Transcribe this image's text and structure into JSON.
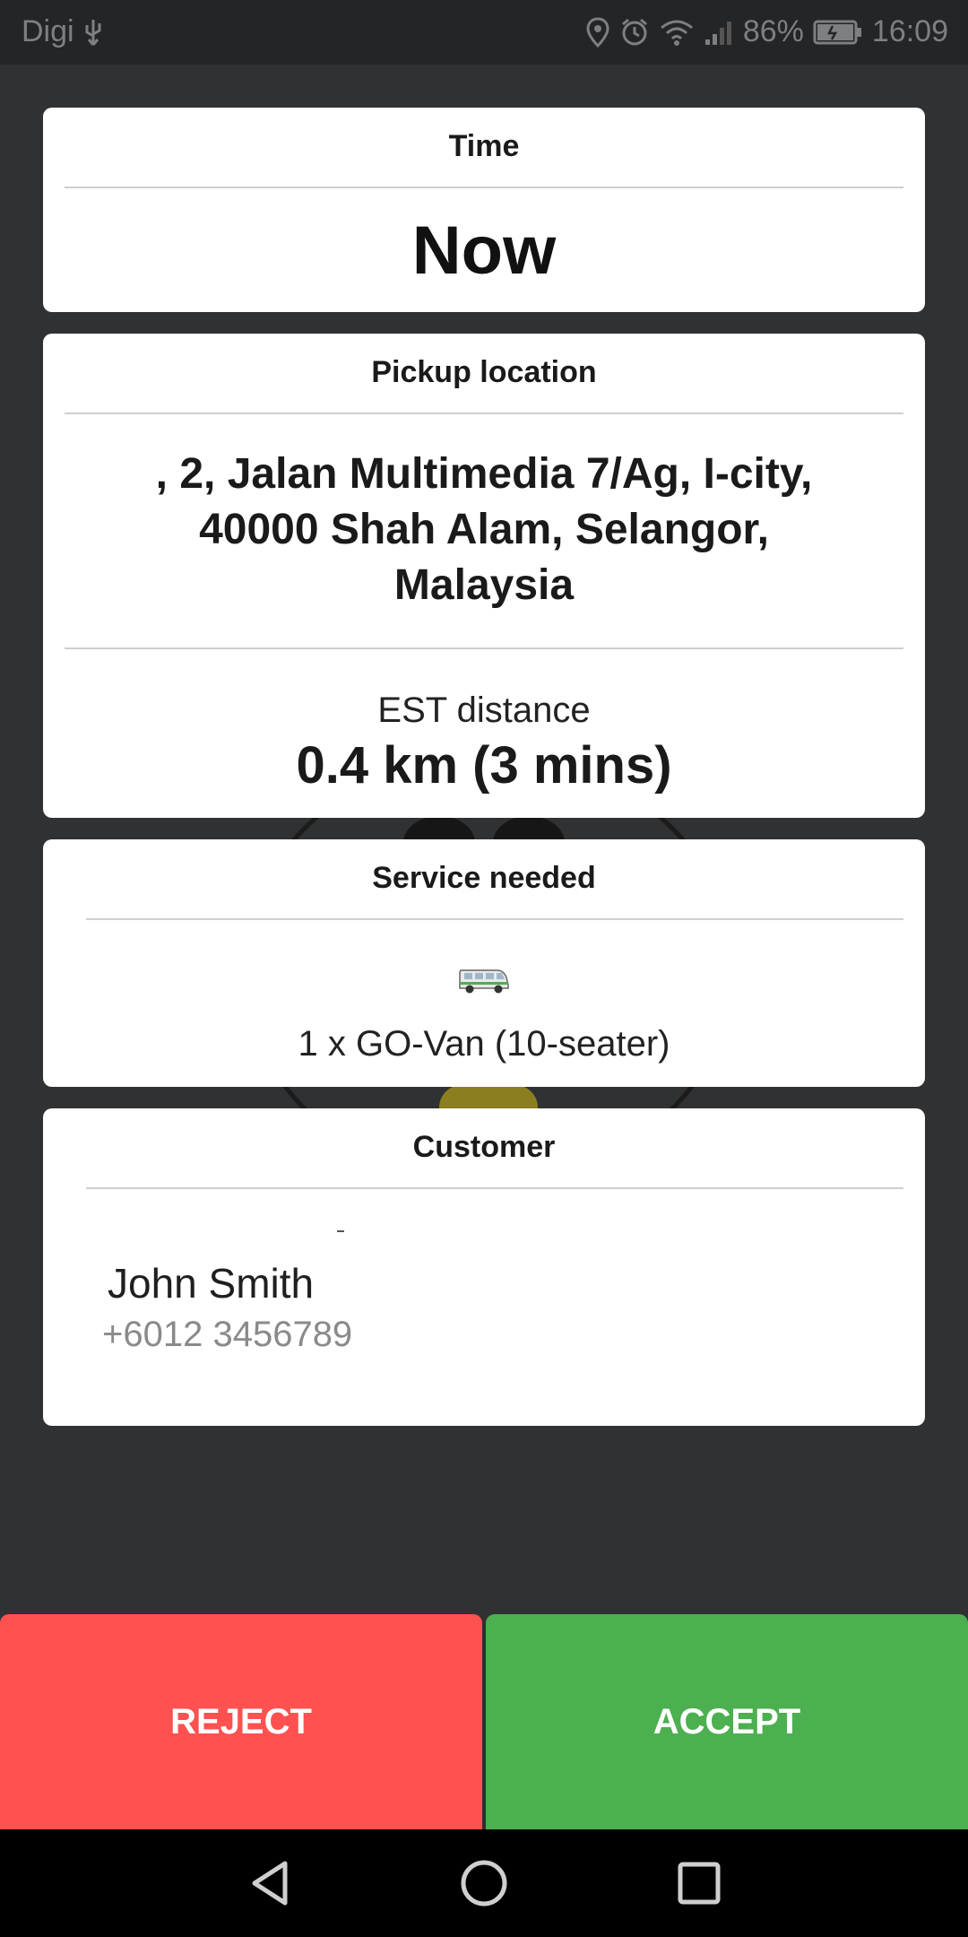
{
  "status_bar": {
    "carrier": "Digi",
    "battery": "86%",
    "time": "16:09"
  },
  "cards": {
    "time": {
      "header": "Time",
      "value": "Now"
    },
    "pickup": {
      "header": "Pickup location",
      "address_lines": [
        ", 2, Jalan Multimedia 7/Ag, I-city,",
        "40000 Shah Alam, Selangor,",
        "Malaysia"
      ],
      "est_label": "EST distance",
      "est_value": "0.4 km (3 mins)"
    },
    "service": {
      "header": "Service needed",
      "icon": "van-icon",
      "text": "1 x GO-Van (10-seater)"
    },
    "customer": {
      "header": "Customer",
      "name": "John Smith",
      "phone": "+6012 3456789"
    }
  },
  "actions": {
    "reject_label": "REJECT",
    "accept_label": "ACCEPT"
  },
  "colors": {
    "reject": "#fe5150",
    "accept": "#4caf50",
    "background": "#2f3132"
  }
}
